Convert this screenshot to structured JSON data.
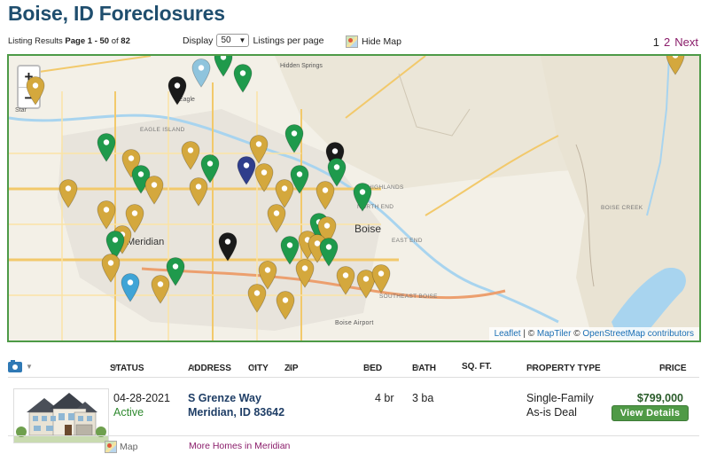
{
  "page_title": "Boise, ID Foreclosures",
  "summary": {
    "prefix": "Listing Results",
    "range": "Page 1 - 50",
    "of_word": "of",
    "total": "82"
  },
  "display": {
    "label": "Display",
    "value": "50",
    "suffix": "Listings per page"
  },
  "hide_map_label": "Hide Map",
  "pager": {
    "current": "1",
    "next_page": "2",
    "next_label": "Next"
  },
  "map": {
    "zoom_in": "+",
    "zoom_out": "−",
    "labels": {
      "boise": "Boise",
      "meridian": "Meridian",
      "eagle": "Eagle",
      "star": "Star",
      "hidden_springs": "Hidden Springs",
      "eagle_island": "EAGLE ISLAND",
      "boise_airport": "Boise Airport",
      "north_end": "NORTH END",
      "east_end": "EAST END",
      "boise_creek": "BOISE CREEK",
      "southeast_boise": "SOUTHEAST BOISE",
      "highlands": "HIGHLANDS"
    },
    "attribution": {
      "leaflet": "Leaflet",
      "sep": " | © ",
      "maptiler": "MapTiler",
      "sep2": " © ",
      "osm": "OpenStreetMap contributors"
    },
    "pin_colors": {
      "gold": "#d4a83d",
      "green": "#1f9a4c",
      "black": "#1a1a1a",
      "navy": "#2f3e8c",
      "lightblue": "#8fc4dd",
      "blue": "#3fa4d6"
    }
  },
  "table": {
    "headers": {
      "status": "STATUS",
      "address": "ADDRESS",
      "city": "CITY",
      "zip": "ZIP",
      "bed": "BED",
      "bath": "BATH",
      "sqft": "SQ. FT.",
      "type": "PROPERTY TYPE",
      "price": "PRICE"
    },
    "rows": [
      {
        "date": "04-28-2021",
        "status": "Active",
        "street": "S Grenze Way",
        "city_line": "Meridian, ID 83642",
        "bed": "4 br",
        "bath": "3 ba",
        "type_line1": "Single-Family",
        "type_line2": "As-is Deal",
        "price": "$799,000",
        "details_label": "View Details",
        "map_label": "Map",
        "more_label": "More Homes in Meridian"
      }
    ]
  }
}
